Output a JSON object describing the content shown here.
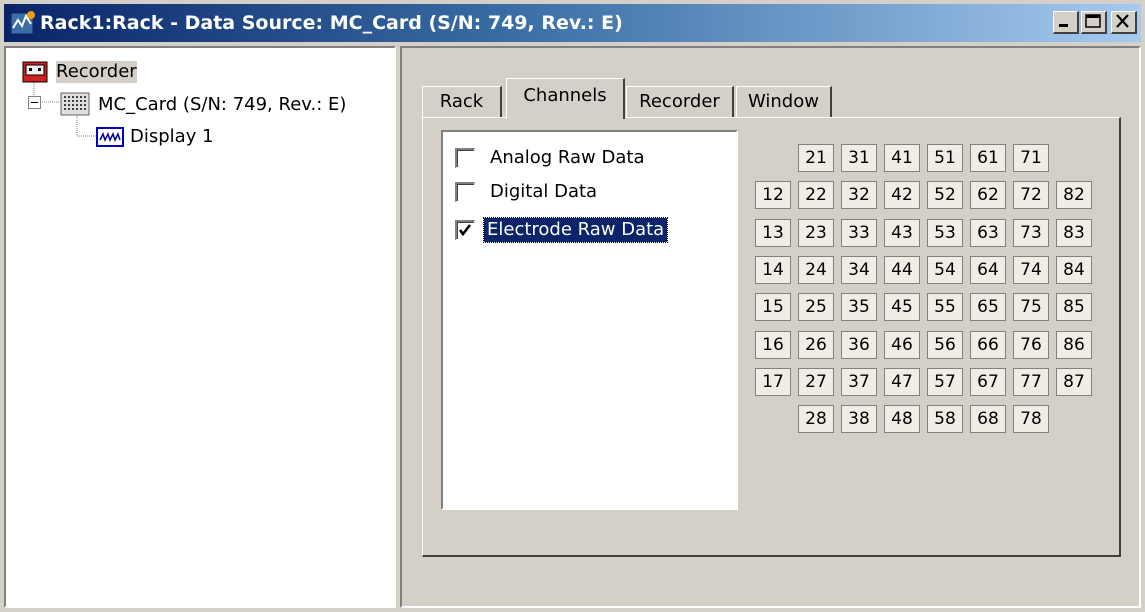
{
  "window": {
    "title": "Rack1:Rack - Data Source: MC_Card (S/N: 749, Rev.: E)",
    "controls": [
      "minimize",
      "maximize",
      "close"
    ]
  },
  "tree": {
    "root_label": "Recorder",
    "child_label": "MC_Card (S/N: 749, Rev.: E)",
    "grandchild_label": "Display 1"
  },
  "tabs": [
    {
      "label": "Rack"
    },
    {
      "label": "Channels"
    },
    {
      "label": "Recorder"
    },
    {
      "label": "Window"
    }
  ],
  "active_tab": "Channels",
  "streams": [
    {
      "label": "Analog Raw Data",
      "checked": false
    },
    {
      "label": "Digital Data",
      "checked": false
    },
    {
      "label": "Electrode Raw Data",
      "checked": true
    }
  ],
  "channel_grid": [
    [
      "",
      "21",
      "31",
      "41",
      "51",
      "61",
      "71",
      ""
    ],
    [
      "12",
      "22",
      "32",
      "42",
      "52",
      "62",
      "72",
      "82"
    ],
    [
      "13",
      "23",
      "33",
      "43",
      "53",
      "63",
      "73",
      "83"
    ],
    [
      "14",
      "24",
      "34",
      "44",
      "54",
      "64",
      "74",
      "84"
    ],
    [
      "15",
      "25",
      "35",
      "45",
      "55",
      "65",
      "75",
      "85"
    ],
    [
      "16",
      "26",
      "36",
      "46",
      "56",
      "66",
      "76",
      "86"
    ],
    [
      "17",
      "27",
      "37",
      "47",
      "57",
      "67",
      "77",
      "87"
    ],
    [
      "",
      "28",
      "38",
      "48",
      "58",
      "68",
      "78",
      ""
    ]
  ]
}
